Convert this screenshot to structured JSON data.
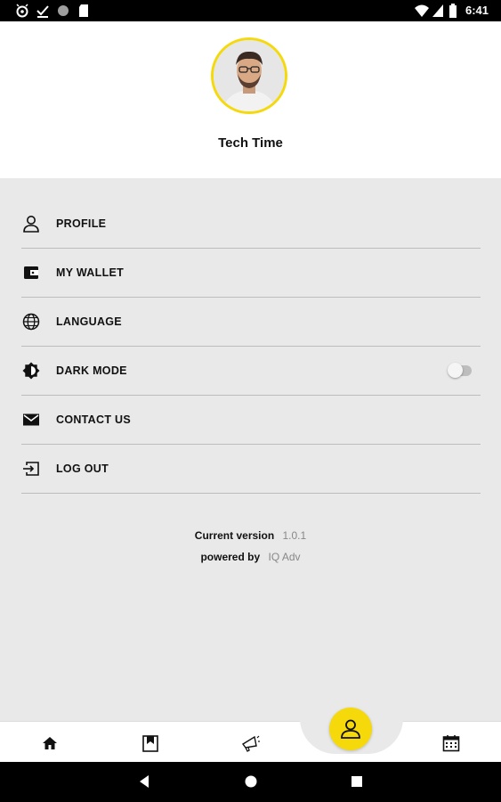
{
  "status_bar": {
    "time": "6:41",
    "icons_left": [
      "android-debug-icon",
      "download-done-icon",
      "circle-icon",
      "sd-card-icon"
    ],
    "icons_right": [
      "wifi-icon",
      "signal-icon",
      "battery-icon"
    ]
  },
  "profile": {
    "name": "Tech Time",
    "avatar": "avatar-photo"
  },
  "menu": {
    "items": [
      {
        "label": "PROFILE",
        "icon": "person-icon"
      },
      {
        "label": "MY WALLET",
        "icon": "wallet-icon"
      },
      {
        "label": "LANGUAGE",
        "icon": "globe-icon"
      },
      {
        "label": "DARK MODE",
        "icon": "brightness-icon",
        "toggle": false
      },
      {
        "label": "CONTACT US",
        "icon": "mail-icon"
      },
      {
        "label": "LOG OUT",
        "icon": "logout-icon"
      }
    ]
  },
  "version": {
    "version_label": "Current version",
    "version_value": "1.0.1",
    "powered_label": "powered by",
    "powered_value": "IQ Adv"
  },
  "bottom_nav": {
    "items": [
      "home-icon",
      "bookmark-icon",
      "megaphone-icon",
      "profile-icon",
      "calendar-icon"
    ],
    "active": "profile-icon"
  },
  "colors": {
    "accent": "#f5d90a",
    "background": "#e9e9e9",
    "divider": "#bdbdbd"
  }
}
